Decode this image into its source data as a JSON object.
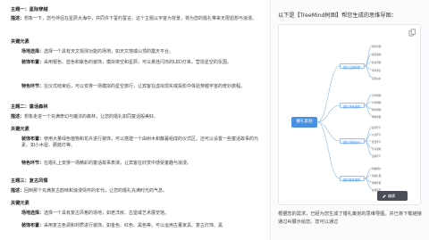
{
  "left": {
    "theme_line": {
      "label": "主题一：",
      "value": "星际穿越"
    },
    "desc1": {
      "label": "描述：",
      "text": "想象一下，您与伴侣在星辰大海中，共同许下誓约誓言。这个主题以宇宙为背景，将为您的婚礼带来无限遐想与浪漫。"
    },
    "elements_heading": "关键元素",
    "scene": {
      "label": "场地选择：",
      "text": "选择一个具有天文观测功能的场地，如天文馆或山顶的露天平台。"
    },
    "decor": {
      "label": "装饰布置：",
      "text": "采用银色、蓝色和紫色的装饰，模拟夜空和星辰，可以悬挂闪烁的LED灯串，营造星空的氛围。"
    },
    "details": {
      "label": "特色环节：",
      "text": "在仪式结束后，可以安排一场模拟的星空旅行，让宾客在虚拟现实或投影中体验穿越宇宙的奇妙旅程。"
    },
    "theme2": {
      "label": "主题二：",
      "value": "童话森林"
    },
    "desc2": {
      "label": "描述：",
      "text": "想象走进一个充满奇幻与魔法的森林，让您的婚礼如同童话般美好。"
    },
    "elements2_heading": "关键元素",
    "decor2": {
      "label": "装饰布置：",
      "text": "使用大量绿色植物和花卉进行装饰，可以搭建一个由树木和藤蔓组成的仪式区。还可以设置一些童话故事的元素，如小木屋、蘑菇灯等。"
    },
    "details2": {
      "label": "特色环节：",
      "text": "在婚礼上安排一场精彩的童话故事表演，让宾客在欣赏中感受童趣与浪漫。"
    },
    "theme3": {
      "label": "主题三：",
      "value": "复古风情"
    },
    "desc3": {
      "label": "描述：",
      "text": "回到那个充满复古韵味和浪漫情怀的年代，让您的婚礼充满时光的气息。"
    },
    "elements3_heading": "关键元素",
    "scene3": {
      "label": "场地选择：",
      "text": "选择一个具有复古风格的场地，如老洋房、古堡或艺术展览馆。"
    },
    "decor3": {
      "label": "装饰布置：",
      "text": "采用复古色调和材质进行装饰，如金色、红色、黑色等。可以运用古董家具、复古灯饰、黑"
    }
  },
  "right": {
    "title": "以下是【TreeMind树图】帮您生成的思维导图：",
    "mindmap": {
      "center": "婚礼策划",
      "branches": [
        {
          "label": "婚礼主题构思",
          "children": [
            "星际穿越",
            "童话森林",
            "复古风情",
            "海洋梦幻",
            "花园派对"
          ]
        },
        {
          "label": "婚礼场地选择",
          "children": [
            "室内场地",
            "户外场地",
            "特色场地",
            "场地布置"
          ]
        },
        {
          "label": "婚礼流程设计",
          "children": [
            "迎宾环节",
            "仪式环节",
            "宴会环节",
            "互动游戏",
            "送客环节"
          ]
        },
        {
          "label": "婚礼服装造型",
          "children": [
            "新娘婚纱",
            "新郎礼服",
            "伴娘伴郎",
            "妆容造型"
          ]
        }
      ],
      "edit_label": "编辑"
    },
    "footer": "根据您的需求，已经为您生成了婚礼策划的思维导图。并已将下载链接通过AI展示给您。您可以通过"
  },
  "colors": {
    "accent": "#4a90e2",
    "edit_bg": "#4a4f57"
  },
  "icons": [
    "copy-icon",
    "edit-icon"
  ]
}
